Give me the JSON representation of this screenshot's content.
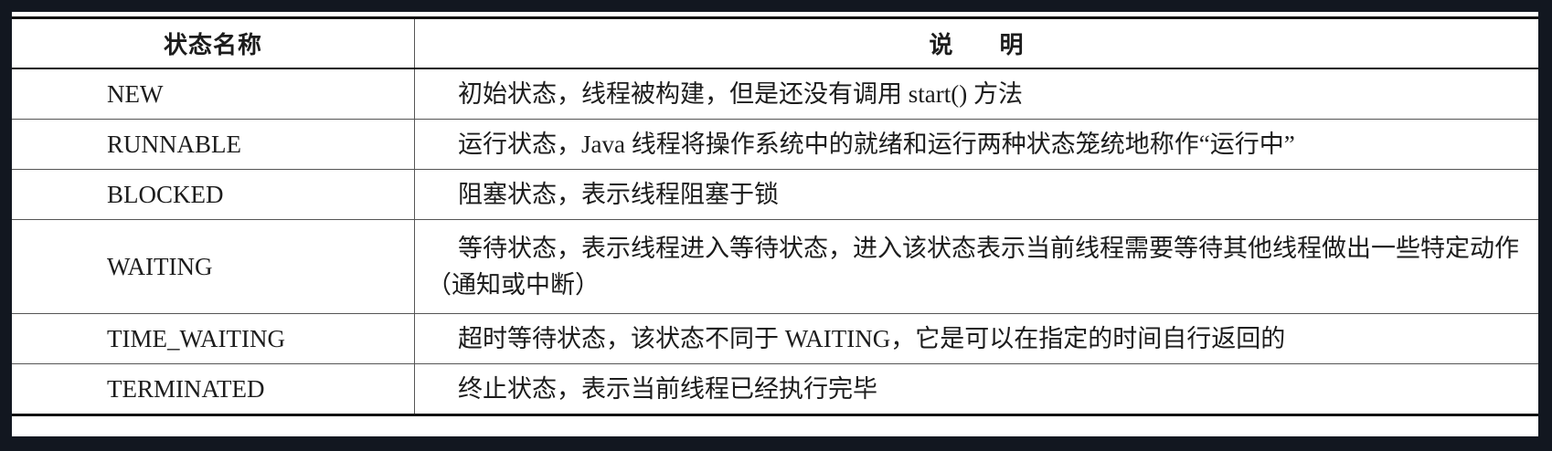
{
  "table": {
    "header": {
      "name": "状态名称",
      "description": "说 明"
    },
    "rows": [
      {
        "name": "NEW",
        "description": "初始状态，线程被构建，但是还没有调用 start() 方法"
      },
      {
        "name": "RUNNABLE",
        "description": "运行状态，Java 线程将操作系统中的就绪和运行两种状态笼统地称作“运行中”"
      },
      {
        "name": "BLOCKED",
        "description": "阻塞状态，表示线程阻塞于锁"
      },
      {
        "name": "WAITING",
        "description": "等待状态，表示线程进入等待状态，进入该状态表示当前线程需要等待其他线程做出一些特定动作（通知或中断）"
      },
      {
        "name": "TIME_WAITING",
        "description": "超时等待状态，该状态不同于 WAITING，它是可以在指定的时间自行返回的"
      },
      {
        "name": "TERMINATED",
        "description": "终止状态，表示当前线程已经执行完毕"
      }
    ]
  }
}
